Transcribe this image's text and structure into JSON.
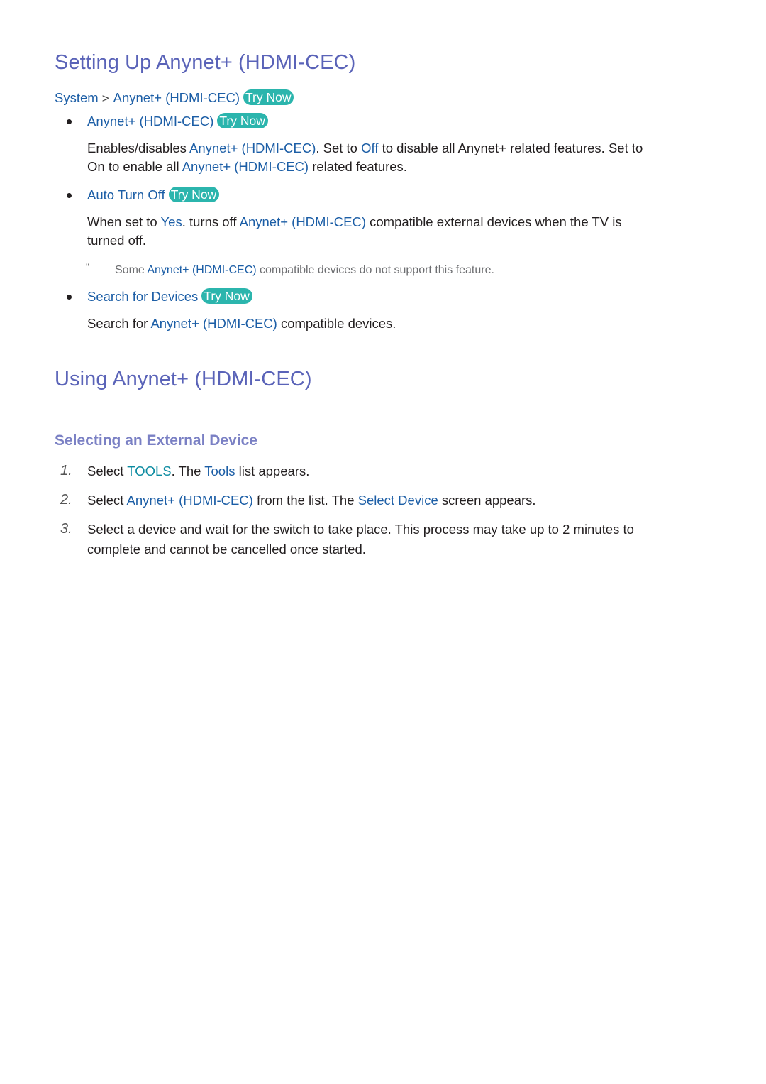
{
  "section1": {
    "title": "Setting Up Anynet+ (HDMI-CEC)",
    "breadcrumb": {
      "items": [
        "System",
        "Anynet+ (HDMI-CEC)"
      ],
      "separator": ">",
      "try_now": "Try Now"
    },
    "items": [
      {
        "label": "Anynet+ (HDMI-CEC)",
        "try_now": "Try Now",
        "desc": {
          "l1_a": "Enables/disables ",
          "l1_b": "Anynet+ (HDMI-CEC)",
          "l1_c": ". Set to ",
          "l1_d": "Off",
          "l1_e": " to disable all Anynet+ related features. Set to",
          "l2_a": "On to enable all ",
          "l2_b": "Anynet+ (HDMI-CEC)",
          "l2_c": " related features."
        }
      },
      {
        "label": "Auto Turn Off",
        "try_now": "Try Now",
        "desc": {
          "l1_a": "When set to ",
          "l1_b": "Yes",
          "l1_c": ". turns off ",
          "l1_d": "Anynet+ (HDMI-CEC)",
          "l1_e": " compatible external devices when the TV is",
          "l2_a": "turned off."
        },
        "note": {
          "mark": "\"",
          "a": "Some ",
          "b": "Anynet+ (HDMI-CEC)",
          "c": " compatible devices do not support this feature."
        }
      },
      {
        "label": "Search for Devices",
        "try_now": "Try Now",
        "desc": {
          "l1_a": "Search for ",
          "l1_b": "Anynet+ (HDMI-CEC)",
          "l1_c": " compatible devices."
        }
      }
    ]
  },
  "section2": {
    "title": "Using Anynet+ (HDMI-CEC)",
    "subtitle": "Selecting an External Device",
    "steps": [
      {
        "num": "1.",
        "a": "Select ",
        "b": "TOOLS",
        "c": ". The ",
        "d": "Tools",
        "e": " list appears."
      },
      {
        "num": "2.",
        "a": "Select ",
        "b": "Anynet+ (HDMI-CEC)",
        "c": " from the list. The ",
        "d": "Select Device",
        "e": " screen appears."
      },
      {
        "num": "3.",
        "l1": "Select a device and wait for the switch to take place. This process may take up to 2 minutes to",
        "l2": "complete and cannot be cancelled once started."
      }
    ]
  },
  "colors": {
    "heading": "#5a63b8",
    "subheading": "#7a80c4",
    "link": "#1c5ea6",
    "button_label": "#0a8aa0",
    "try_now_bg": "#2bb5ad",
    "body_text": "#231f20",
    "note_text": "#6d6e71"
  }
}
